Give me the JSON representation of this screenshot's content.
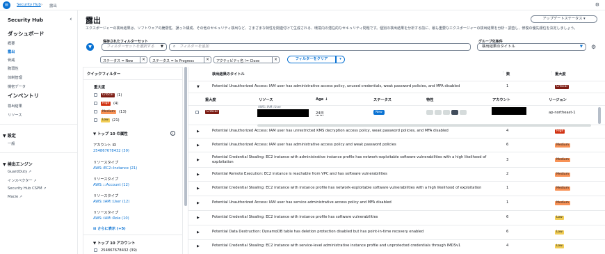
{
  "topbar": {
    "service": "Security Hub",
    "separator": "›",
    "current": "露出"
  },
  "sidebar": {
    "title": "Security Hub",
    "collapse": "‹",
    "dashboard": "ダッシュボード",
    "items1": [
      "概要",
      "露出",
      "脅威",
      "脆弱性",
      "体制管理",
      "機密データ"
    ],
    "inventory": "インベントリ",
    "items2": [
      "検出結果",
      "リソース"
    ],
    "settings_title": "設定",
    "settings_items": [
      "一般"
    ],
    "engines_title": "検出エンジン",
    "engines": [
      "GuardDuty",
      "インスペクター",
      "Security Hub CSPM",
      "Macie"
    ],
    "ext_icon": "↗"
  },
  "header": {
    "title": "露出",
    "update_status": "アップデートステータス",
    "description": "エクスポージャーの検出結果は、ソフトウェアの脆弱性、誤った構成、その他のセキュリティ検出など、さまざまな特性を関連付けて生成される、環境内の潜在的なセキュリティ問題です。個別の検出結果を分析する前に、最も重要なエクスポージャーの検出結果を分析・調査し、修復の優先順位を決定しましょう。"
  },
  "filters": {
    "saved_label": "保存されたフィルターセット",
    "saved_placeholder": "フィルターセットを選択する",
    "search_placeholder": "フィルターを追加",
    "groupby_label": "グループ化条件",
    "groupby_value": "検出結果のタイトル",
    "tokens": [
      "ステータス = New",
      "ステータス = In Progress",
      "アクティビティ名 != Close"
    ],
    "clear": "フィルターをクリア"
  },
  "quick": {
    "title": "クイックフィルター",
    "severity_title": "重大度",
    "severity": [
      {
        "label": "Critical",
        "count": "(1)"
      },
      {
        "label": "High",
        "count": "(4)"
      },
      {
        "label": "Medium",
        "count": "(13)"
      },
      {
        "label": "Low",
        "count": "(21)"
      }
    ],
    "top_attr_title": "トップ 10 の属性",
    "account_label": "アカウント ID",
    "account_value": "254867678432 (39)",
    "rt1_label": "リソースタイプ",
    "rt1_value": "AWS::EC2::Instance (21)",
    "rt2_label": "リソースタイプ",
    "rt2_value": "AWS::::Account (12)",
    "rt3_label": "リソースタイプ",
    "rt3_value": "AWS::IAM::User (12)",
    "rt4_label": "リソースタイプ",
    "rt4_value": "AWS::IAM::Role (10)",
    "more": "さらに表示 (+5)",
    "top_acct_title": "トップ 10 アカウント",
    "top_acct_value": "254867678432 (39)"
  },
  "table": {
    "headers": {
      "title": "検出結果のタイトル",
      "count": "数",
      "severity": "重大度"
    },
    "expanded": {
      "title": "Potential Unauthorized Access: IAM user has administrative access policy, unused credentials, weak password policies, and MFA disabled",
      "count": "1",
      "severity": "Critical",
      "sub_headers": {
        "severity": "重大度",
        "resource": "リソース",
        "age": "Age",
        "status": "ステータス",
        "traits": "特性",
        "account": "アカウント",
        "region": "リージョン"
      },
      "sub_row": {
        "severity": "Critical",
        "resource_type": "AWS::IAM::User",
        "age": "24日",
        "status": "New",
        "region": "ap-northeast-1"
      }
    },
    "rows": [
      {
        "title": "Potential Unauthorized Access: IAM user has unrestricted KMS decryption access policy, weak password policies, and MFA disabled",
        "count": "4",
        "severity": "High"
      },
      {
        "title": "Potential Unauthorized Access: IAM user has administrative access policy and weak password policies",
        "count": "6",
        "severity": "Medium"
      },
      {
        "title": "Potential Credential Stealing: EC2 instance with administrative instance profile has network-exploitable software vulnerabilities with a high likelihood of exploitation",
        "count": "3",
        "severity": "Medium"
      },
      {
        "title": "Potential Remote Execution: EC2 instance is reachable from VPC and has software vulnerabilities",
        "count": "2",
        "severity": "Medium"
      },
      {
        "title": "Potential Credential Stealing: EC2 instance with instance profile has network-exploitable software vulnerabilities with a high likelihood of exploitation",
        "count": "1",
        "severity": "Medium"
      },
      {
        "title": "Potential Unauthorized Access: IAM user has service administrative access policy and MFA disabled",
        "count": "1",
        "severity": "Medium"
      },
      {
        "title": "Potential Credential Stealing: EC2 instance with instance profile has software vulnerabilities",
        "count": "6",
        "severity": "Low"
      },
      {
        "title": "Potential Data Destruction: DynamoDB table has deletion protection disabled but has point-in-time recovery enabled",
        "count": "6",
        "severity": "Low"
      },
      {
        "title": "Potential Credential Stealing: EC2 instance with service-level administrative instance profile and unprotected credentials through IMDSv1",
        "count": "4",
        "severity": "Low"
      }
    ]
  },
  "colors": {
    "accent": "#0972d3",
    "critical": "#7d1c14",
    "high": "#d13212",
    "medium": "#f89256",
    "low": "#f2cd54"
  }
}
